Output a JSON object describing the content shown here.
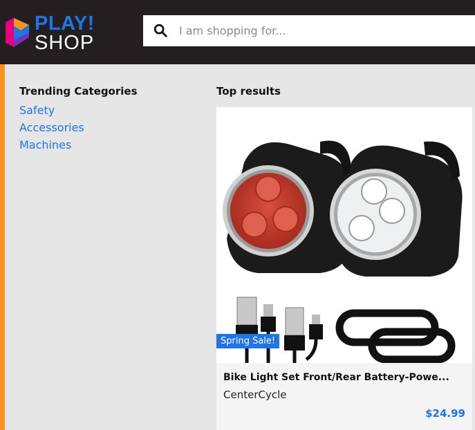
{
  "header": {
    "logo": {
      "line1": "PLAY!",
      "line2": "SHOP"
    },
    "search": {
      "placeholder": "I am shopping for..."
    }
  },
  "dropdown": {
    "trending": {
      "title": "Trending Categories",
      "items": [
        "Safety",
        "Accessories",
        "Machines"
      ]
    },
    "results": {
      "title": "Top results",
      "items": [
        {
          "badge": "Spring Sale!",
          "name": "Bike Light Set Front/Rear Battery-Powe...",
          "brand": "CenterCycle",
          "price": "$24.99"
        }
      ]
    }
  },
  "colors": {
    "brand_blue": "#1f74e6",
    "accent_orange": "#f7941d",
    "header_bg": "#231f20"
  }
}
